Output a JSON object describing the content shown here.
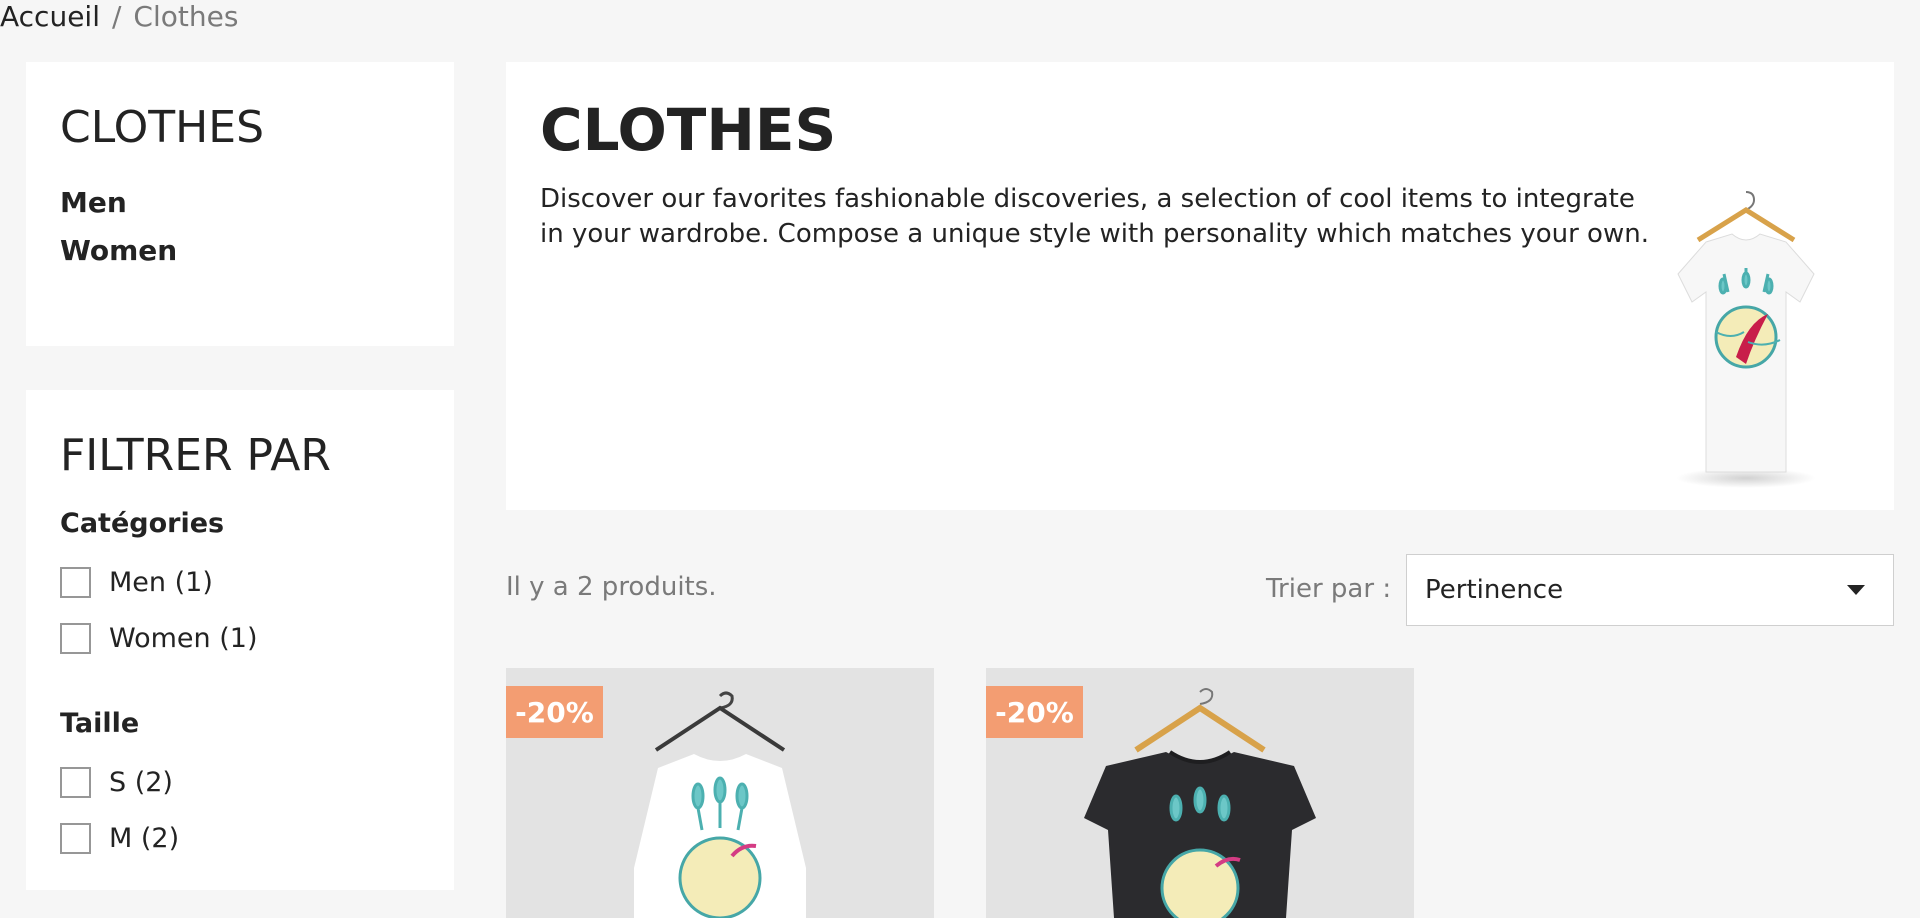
{
  "breadcrumb": {
    "home": "Accueil",
    "separator": "/",
    "current": "Clothes"
  },
  "category_tree": {
    "title": "CLOTHES",
    "items": [
      {
        "label": "Men"
      },
      {
        "label": "Women"
      }
    ]
  },
  "filters": {
    "title": "FILTRER PAR",
    "facets": [
      {
        "title": "Catégories",
        "options": [
          {
            "label": "Men (1)"
          },
          {
            "label": "Women (1)"
          }
        ]
      },
      {
        "title": "Taille",
        "options": [
          {
            "label": "S (2)"
          },
          {
            "label": "M (2)"
          }
        ]
      }
    ]
  },
  "category": {
    "title": "CLOTHES",
    "description": "Discover our favorites fashionable discoveries, a selection of cool items to integrate in your wardrobe. Compose a unique style with personality which matches your own."
  },
  "listing": {
    "count_text": "Il y a 2 produits.",
    "sort_label": "Trier par :",
    "sort_value": "Pertinence"
  },
  "products": [
    {
      "discount": "-20%",
      "shirt_color": "#ffffff"
    },
    {
      "discount": "-20%",
      "shirt_color": "#2b2b2e"
    }
  ],
  "colors": {
    "page_bg": "#f6f6f6",
    "text": "#232323",
    "muted": "#7a7a7a",
    "discount_flag": "#f39d72",
    "product_bg": "#e3e3e3"
  }
}
